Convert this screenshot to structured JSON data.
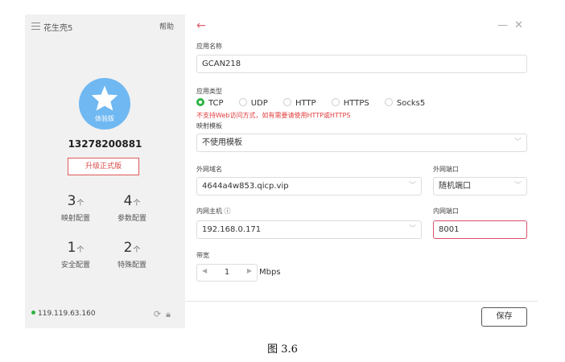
{
  "sidebar": {
    "app_title": "花生壳5",
    "help": "帮助",
    "avatar_badge": "体验版",
    "phone": "13278200881",
    "upgrade": "升级正式版",
    "stats": [
      {
        "value": "3",
        "unit": "个",
        "label": "映射配置"
      },
      {
        "value": "4",
        "unit": "个",
        "label": "参数配置"
      },
      {
        "value": "1",
        "unit": "个",
        "label": "安全配置"
      },
      {
        "value": "2",
        "unit": "个",
        "label": "特殊配置"
      }
    ],
    "ip": "119.119.63.160",
    "status_color": "#2fb344"
  },
  "dialog": {
    "back_icon": "←",
    "minimize_icon": "—",
    "close_icon": "✕",
    "app_name_label": "应用名称",
    "app_name_value": "GCAN218",
    "app_type_label": "应用类型",
    "app_types": [
      "TCP",
      "UDP",
      "HTTP",
      "HTTPS",
      "Socks5"
    ],
    "app_type_selected": "TCP",
    "warning": "不支持Web访问方式，如有需要请使用HTTP或HTTPS",
    "template_label": "映射模板",
    "template_value": "不使用模板",
    "ext_domain_label": "外网域名",
    "ext_domain_value": "4644a4w853.qicp.vip",
    "ext_port_label": "外网端口",
    "ext_port_value": "随机端口",
    "int_host_label": "内网主机",
    "int_host_value": "192.168.0.171",
    "int_port_label": "内网端口",
    "int_port_value": "8001",
    "bandwidth_label": "带宽",
    "bandwidth_value": "1",
    "bandwidth_unit": "Mbps",
    "save": "保存",
    "accent_color": "#d9506a"
  },
  "caption": "图 3.6"
}
